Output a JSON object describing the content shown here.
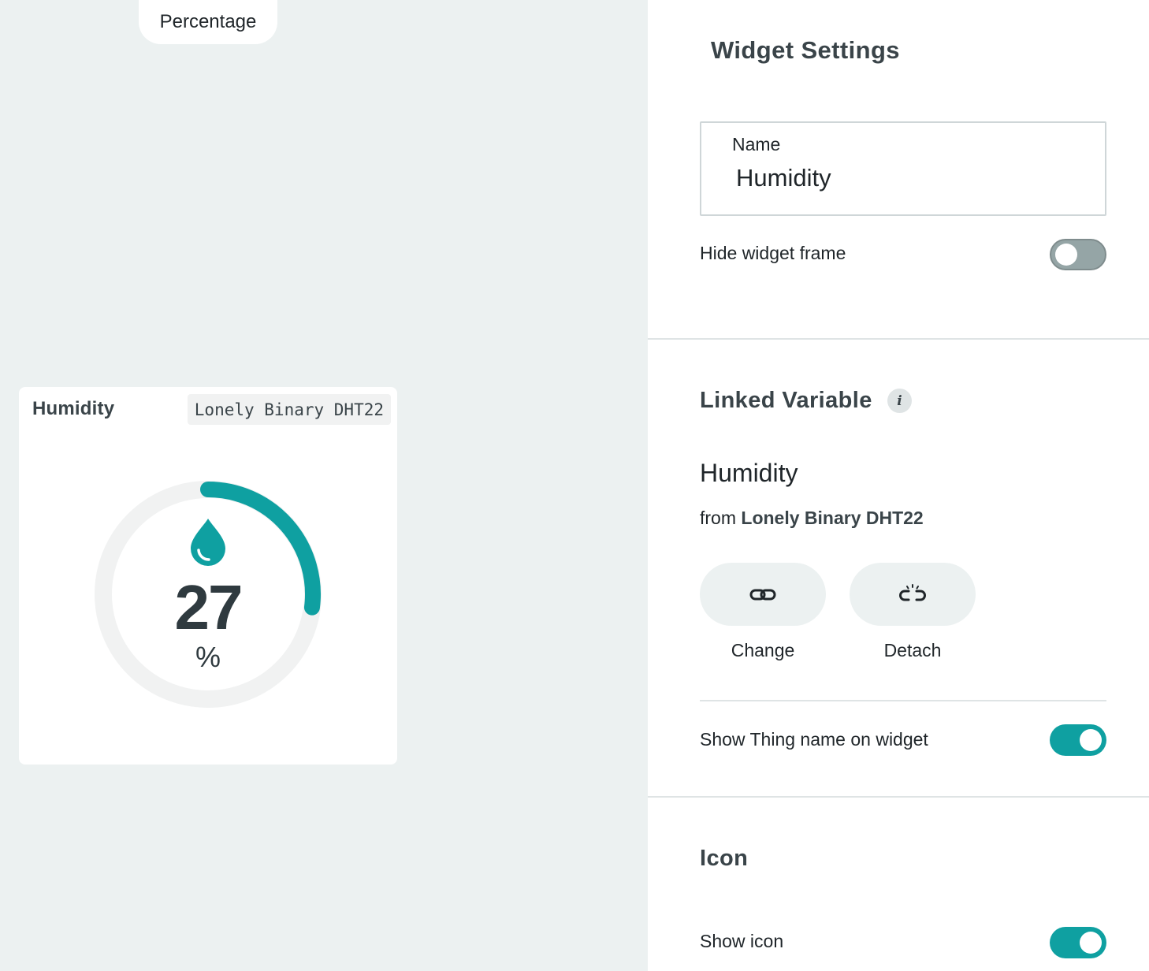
{
  "canvas": {
    "mode_pill": "Percentage"
  },
  "widget": {
    "title": "Humidity",
    "thing_name": "Lonely Binary DHT22",
    "icon": "water-drop-icon",
    "value": "27",
    "unit": "%",
    "gauge_fraction": 0.27,
    "accent_color": "#0fa0a1"
  },
  "settings": {
    "title": "Widget Settings",
    "name_label": "Name",
    "name_value": "Humidity",
    "hide_frame_label": "Hide widget frame",
    "hide_frame_on": false,
    "linked": {
      "title": "Linked Variable",
      "info_icon": "info-icon",
      "info_glyph": "i",
      "variable": "Humidity",
      "from_prefix": "from",
      "from_thing": "Lonely Binary DHT22",
      "change_label": "Change",
      "change_icon": "link-icon",
      "detach_label": "Detach",
      "detach_icon": "unlink-icon",
      "show_thing_label": "Show Thing name on widget",
      "show_thing_on": true
    },
    "icon_section": {
      "title": "Icon",
      "show_icon_label": "Show icon",
      "show_icon_on": true
    }
  }
}
